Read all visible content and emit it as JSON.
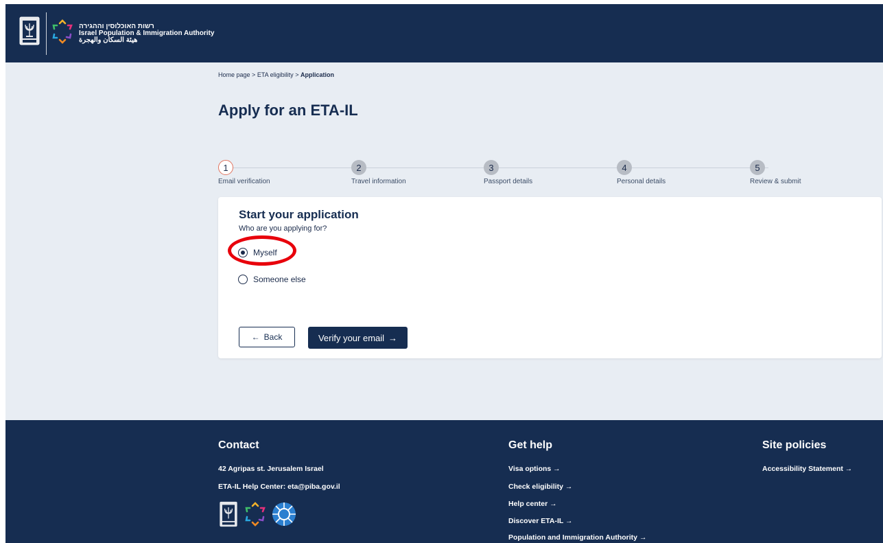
{
  "header": {
    "org_hebrew": "רשות האוכלוסין וההגירה",
    "org_english": "Israel Population & Immigration Authority",
    "org_arabic": "هيئة السكان والهجرة",
    "emblem_icon": "menorah-emblem-icon",
    "logo_icon": "star-logo-icon"
  },
  "breadcrumb": {
    "home": "Home page",
    "sep1": ">",
    "eligibility": "ETA eligibility",
    "sep2": ">",
    "current": "Application"
  },
  "page": {
    "title": "Apply for an ETA-IL"
  },
  "stepper": {
    "steps": [
      {
        "number": "1",
        "label": "Email verification",
        "active": true
      },
      {
        "number": "2",
        "label": "Travel information",
        "active": false
      },
      {
        "number": "3",
        "label": "Passport details",
        "active": false
      },
      {
        "number": "4",
        "label": "Personal details",
        "active": false
      },
      {
        "number": "5",
        "label": "Review & submit",
        "active": false
      }
    ]
  },
  "form": {
    "title": "Start your application",
    "question": "Who are you applying for?",
    "options": [
      {
        "label": "Myself",
        "selected": true
      },
      {
        "label": "Someone else",
        "selected": false
      }
    ],
    "back_label": "Back",
    "back_icon": "arrow-left-icon",
    "verify_label": "Verify your email",
    "verify_icon": "arrow-right-icon"
  },
  "footer": {
    "contact": {
      "heading": "Contact",
      "address": "42 Agripas st. Jerusalem Israel",
      "help_center": "ETA-IL Help Center: eta@piba.gov.il"
    },
    "help": {
      "heading": "Get help",
      "links": [
        "Visa options →",
        "Check eligibility →",
        "Help center →",
        "Discover ETA-IL →",
        "Population and Immigration Authority →"
      ]
    },
    "policies": {
      "heading": "Site policies",
      "links": [
        "Accessibility Statement →"
      ]
    }
  },
  "colors": {
    "navy": "#162d51",
    "page_bg": "#e8edf3",
    "active_step_border": "#e0745f",
    "highlight_ring": "#e8000b"
  }
}
